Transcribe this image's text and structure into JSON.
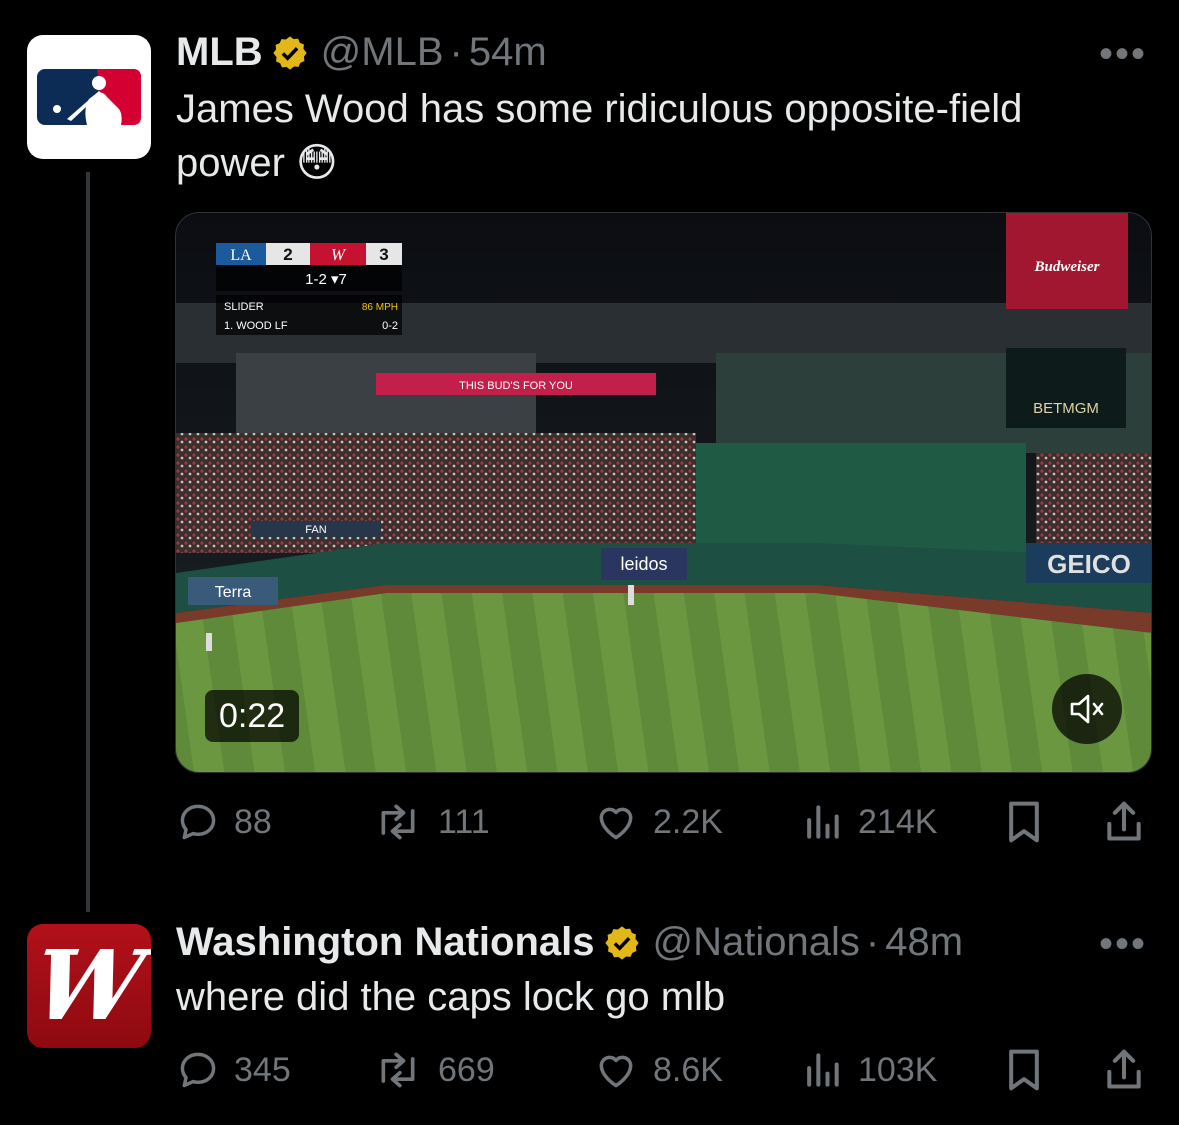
{
  "tweets": [
    {
      "author": "MLB",
      "handle": "@MLB",
      "separator": "·",
      "time": "54m",
      "text": "James Wood has some ridiculous opposite-field power 😳",
      "more": "•••",
      "media": {
        "duration": "0:22",
        "mute_icon": "speaker-muted-icon",
        "scoreboard": {
          "away_team": "LA",
          "away_score": "2",
          "home_team": "W",
          "home_score": "3",
          "count": "1-2",
          "inning": "7",
          "pitch": "SLIDER",
          "speed": "86 MPH",
          "batter": "1. WOOD LF",
          "batter_count": "0-2"
        },
        "signs": [
          "Budweiser",
          "BETMGM",
          "GEICO",
          "leidos",
          "Terra",
          "THIS BUD'S FOR YOU",
          "FAN"
        ]
      },
      "actions": {
        "replies": "88",
        "reposts": "111",
        "likes": "2.2K",
        "views": "214K"
      }
    },
    {
      "author": "Washington Nationals",
      "handle": "@Nationals",
      "separator": "·",
      "time": "48m",
      "text": "where did the caps lock go mlb",
      "more": "•••",
      "actions": {
        "replies": "345",
        "reposts": "669",
        "likes": "8.6K",
        "views": "103K"
      }
    }
  ],
  "colors": {
    "verified_gold": "#e2b719",
    "muted_text": "#71767b",
    "primary_text": "#e7e9ea",
    "nats_red": "#ab0003",
    "mlb_blue": "#0c2c56",
    "mlb_red": "#d50032"
  }
}
